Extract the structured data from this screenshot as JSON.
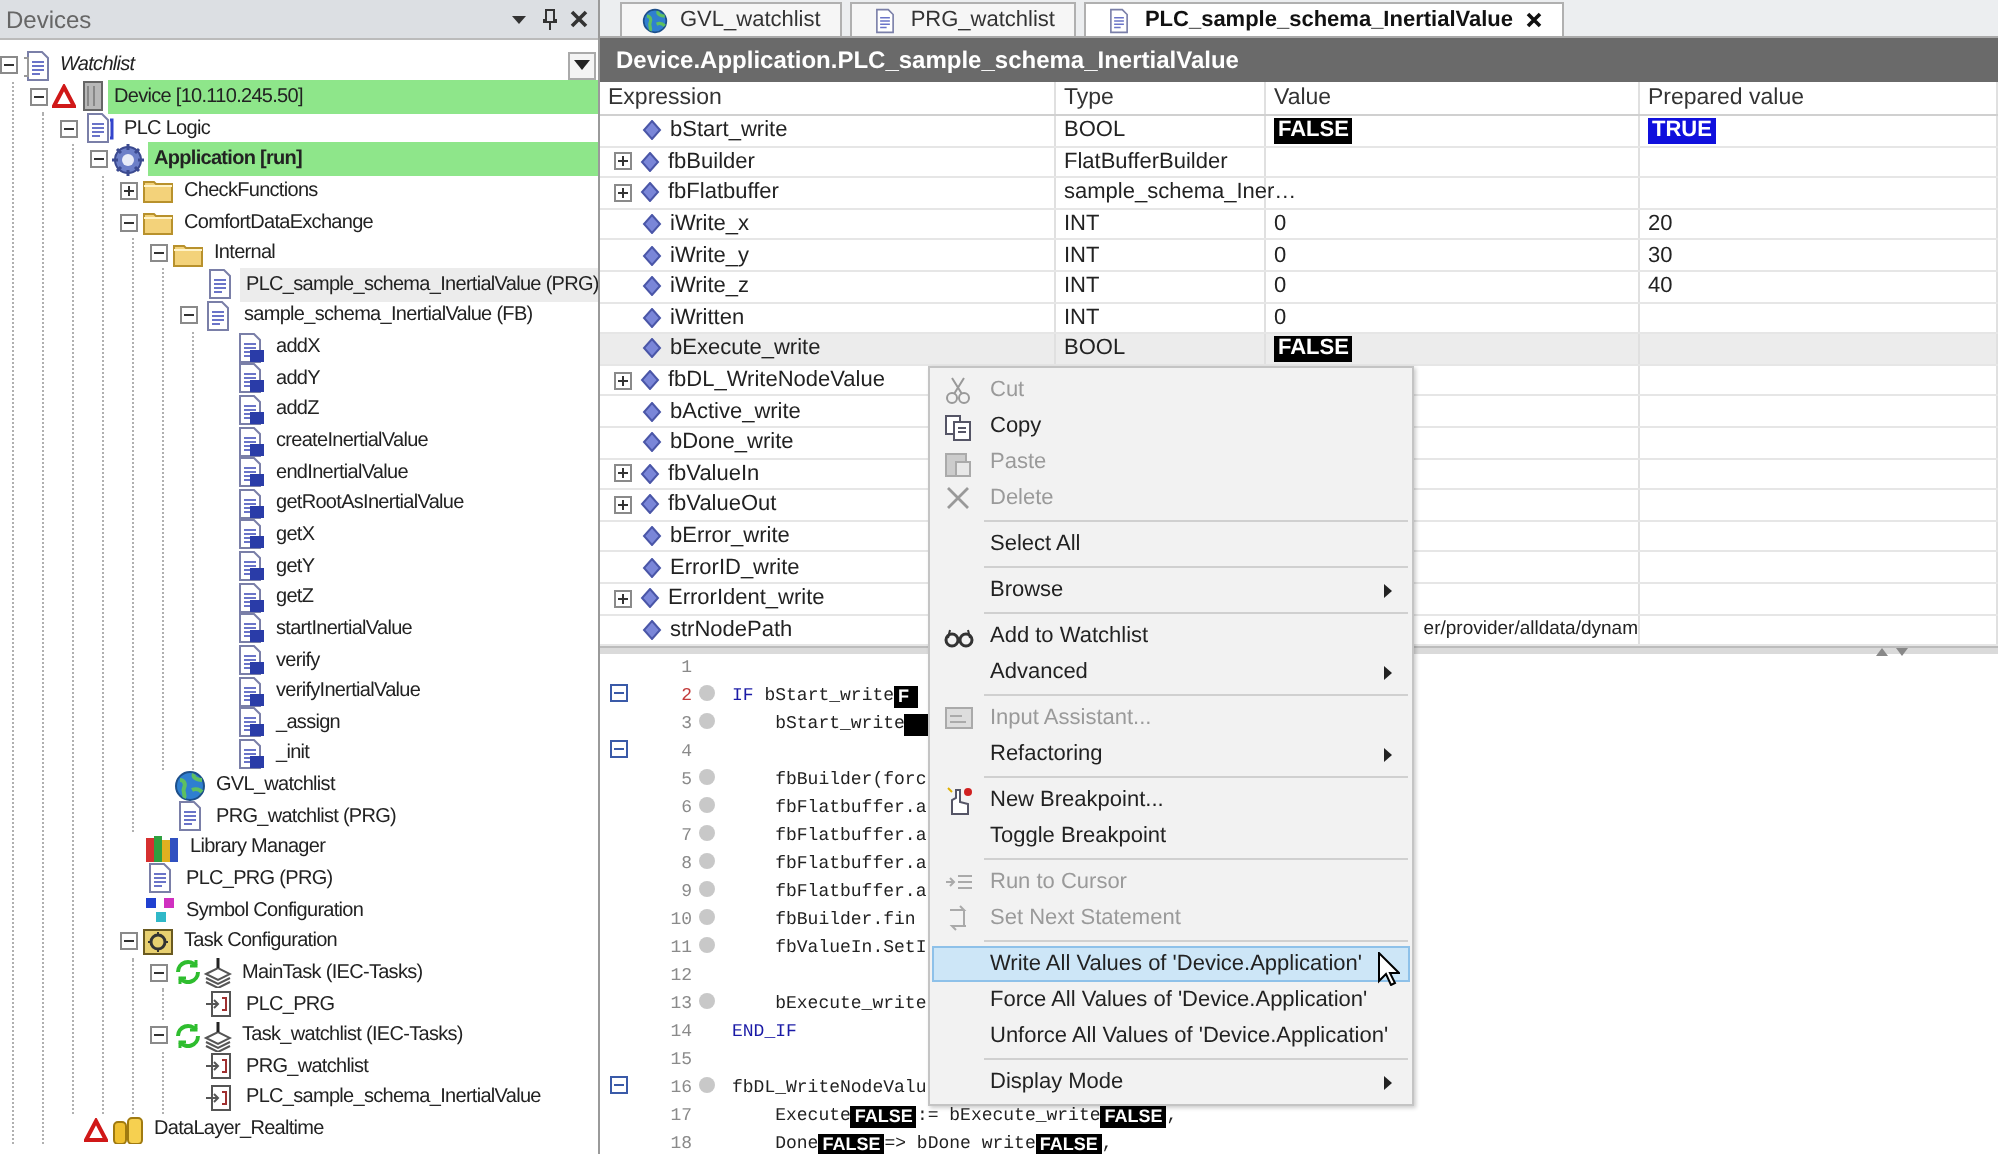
{
  "devices_panel": {
    "title": "Devices",
    "tree": [
      {
        "label": "Watchlist",
        "kind": "watchlist",
        "expanded": true,
        "selected": false,
        "children": [
          {
            "label": "Device  [10.110.245.50]",
            "kind": "device",
            "warning": true,
            "running": true,
            "expanded": true,
            "selected": false,
            "children": [
              {
                "label": "PLC Logic",
                "kind": "plc",
                "expanded": true,
                "selected": false,
                "children": [
                  {
                    "label": "Application [run]",
                    "kind": "application",
                    "running": true,
                    "expanded": true,
                    "selected": false,
                    "children": [
                      {
                        "label": "CheckFunctions",
                        "kind": "folder",
                        "expanded": false,
                        "selected": false
                      },
                      {
                        "label": "ComfortDataExchange",
                        "kind": "folder",
                        "expanded": true,
                        "selected": false,
                        "children": [
                          {
                            "label": "Internal",
                            "kind": "folder",
                            "expanded": true,
                            "selected": false,
                            "children": [
                              {
                                "label": "PLC_sample_schema_InertialValue (PRG)",
                                "kind": "pou",
                                "selected": true
                              },
                              {
                                "label": "sample_schema_InertialValue (FB)",
                                "kind": "pou",
                                "expanded": true,
                                "selected": false,
                                "children": [
                                  {
                                    "label": "addX",
                                    "kind": "method",
                                    "selected": false
                                  },
                                  {
                                    "label": "addY",
                                    "kind": "method",
                                    "selected": false
                                  },
                                  {
                                    "label": "addZ",
                                    "kind": "method",
                                    "selected": false
                                  },
                                  {
                                    "label": "createInertialValue",
                                    "kind": "method",
                                    "selected": false
                                  },
                                  {
                                    "label": "endInertialValue",
                                    "kind": "method",
                                    "selected": false
                                  },
                                  {
                                    "label": "getRootAsInertialValue",
                                    "kind": "method",
                                    "selected": false
                                  },
                                  {
                                    "label": "getX",
                                    "kind": "method",
                                    "selected": false
                                  },
                                  {
                                    "label": "getY",
                                    "kind": "method",
                                    "selected": false
                                  },
                                  {
                                    "label": "getZ",
                                    "kind": "method",
                                    "selected": false
                                  },
                                  {
                                    "label": "startInertialValue",
                                    "kind": "method",
                                    "selected": false
                                  },
                                  {
                                    "label": "verify",
                                    "kind": "method",
                                    "selected": false
                                  },
                                  {
                                    "label": "verifyInertialValue",
                                    "kind": "method",
                                    "selected": false
                                  },
                                  {
                                    "label": "_assign",
                                    "kind": "method",
                                    "selected": false
                                  },
                                  {
                                    "label": "_init",
                                    "kind": "method",
                                    "selected": false
                                  }
                                ]
                              }
                            ]
                          },
                          {
                            "label": "GVL_watchlist",
                            "kind": "gvl",
                            "selected": false
                          },
                          {
                            "label": "PRG_watchlist (PRG)",
                            "kind": "pou",
                            "selected": false
                          }
                        ]
                      },
                      {
                        "label": "Library Manager",
                        "kind": "library",
                        "selected": false
                      },
                      {
                        "label": "PLC_PRG (PRG)",
                        "kind": "pou",
                        "selected": false
                      },
                      {
                        "label": "Symbol Configuration",
                        "kind": "symbol",
                        "selected": false
                      },
                      {
                        "label": "Task Configuration",
                        "kind": "tasks",
                        "expanded": true,
                        "selected": false,
                        "children": [
                          {
                            "label": "MainTask (IEC-Tasks)",
                            "kind": "task",
                            "expanded": true,
                            "selected": false,
                            "children": [
                              {
                                "label": "PLC_PRG",
                                "kind": "call",
                                "selected": false
                              }
                            ]
                          },
                          {
                            "label": "Task_watchlist (IEC-Tasks)",
                            "kind": "task",
                            "expanded": true,
                            "selected": false,
                            "children": [
                              {
                                "label": "PRG_watchlist",
                                "kind": "call",
                                "selected": false
                              },
                              {
                                "label": "PLC_sample_schema_InertialValue",
                                "kind": "call",
                                "selected": false
                              }
                            ]
                          }
                        ]
                      }
                    ]
                  }
                ]
              },
              {
                "label": "DataLayer_Realtime",
                "kind": "datalayer",
                "warning": true,
                "selected": false
              }
            ]
          }
        ]
      }
    ]
  },
  "editor_tabs": [
    {
      "label": "GVL_watchlist",
      "kind": "gvl",
      "selected": false
    },
    {
      "label": "PRG_watchlist",
      "kind": "pou",
      "selected": false
    },
    {
      "label": "PLC_sample_schema_InertialValue",
      "kind": "pou",
      "selected": true
    }
  ],
  "watch_title": "Device.Application.PLC_sample_schema_InertialValue",
  "watch_table": {
    "columns": [
      "Expression",
      "Type",
      "Value",
      "Prepared value"
    ],
    "rows": [
      {
        "expression": "bStart_write",
        "type": "BOOL",
        "value": "FALSE",
        "value_boxed": true,
        "prepared": "TRUE",
        "prepared_boxed": true,
        "selected": false
      },
      {
        "expression": "fbBuilder",
        "expanded": false,
        "type": "FlatBufferBuilder",
        "selected": false
      },
      {
        "expression": "fbFlatbuffer",
        "expanded": false,
        "type": "sample_schema_Iner…",
        "selected": false
      },
      {
        "expression": "iWrite_x",
        "type": "INT",
        "value": "0",
        "value_boxed": false,
        "prepared": "20",
        "prepared_boxed": false,
        "selected": false
      },
      {
        "expression": "iWrite_y",
        "type": "INT",
        "value": "0",
        "value_boxed": false,
        "prepared": "30",
        "prepared_boxed": false,
        "selected": false
      },
      {
        "expression": "iWrite_z",
        "type": "INT",
        "value": "0",
        "value_boxed": false,
        "prepared": "40",
        "prepared_boxed": false,
        "selected": false
      },
      {
        "expression": "iWritten",
        "type": "INT",
        "value": "0",
        "value_boxed": false,
        "selected": false
      },
      {
        "expression": "bExecute_write",
        "type": "BOOL",
        "value": "FALSE",
        "value_boxed": true,
        "selected": true
      },
      {
        "expression": "fbDL_WriteNodeValue",
        "expanded": false,
        "selected": false
      },
      {
        "expression": "bActive_write",
        "selected": false
      },
      {
        "expression": "bDone_write",
        "selected": false
      },
      {
        "expression": "fbValueIn",
        "expanded": false,
        "selected": false
      },
      {
        "expression": "fbValueOut",
        "expanded": false,
        "selected": false
      },
      {
        "expression": "bError_write",
        "selected": false
      },
      {
        "expression": "ErrorID_write",
        "selected": false
      },
      {
        "expression": "ErrorIdent_write",
        "expanded": false,
        "selected": false
      },
      {
        "expression": "strNodePath",
        "value": "er/provider/alldata/dynam",
        "value_boxed": false,
        "selected": false
      }
    ]
  },
  "code": {
    "lines": [
      {
        "number": "1",
        "fold": false,
        "breakpoint": false,
        "current": false
      },
      {
        "number": "2",
        "fold": true,
        "breakpoint": true,
        "current": true,
        "segments": [
          {
            "kind": "keyword",
            "text": "IF"
          },
          {
            "kind": "plain",
            "text": " bStart_write"
          },
          {
            "kind": "value",
            "text": "F"
          }
        ]
      },
      {
        "number": "3",
        "fold": false,
        "breakpoint": true,
        "current": false,
        "segments": [
          {
            "kind": "plain",
            "text": "    bStart_write"
          },
          {
            "kind": "value"
          }
        ]
      },
      {
        "number": "4",
        "fold": true,
        "breakpoint": false,
        "current": false
      },
      {
        "number": "5",
        "fold": false,
        "breakpoint": true,
        "current": false,
        "segments": [
          {
            "kind": "plain",
            "text": "    fbBuilder(forc"
          }
        ]
      },
      {
        "number": "6",
        "fold": false,
        "breakpoint": true,
        "current": false,
        "segments": [
          {
            "kind": "plain",
            "text": "    fbFlatbuffer.a"
          }
        ]
      },
      {
        "number": "7",
        "fold": false,
        "breakpoint": true,
        "current": false,
        "segments": [
          {
            "kind": "plain",
            "text": "    fbFlatbuffer.a"
          }
        ]
      },
      {
        "number": "8",
        "fold": false,
        "breakpoint": true,
        "current": false,
        "segments": [
          {
            "kind": "plain",
            "text": "    fbFlatbuffer.a"
          }
        ]
      },
      {
        "number": "9",
        "fold": false,
        "breakpoint": true,
        "current": false,
        "segments": [
          {
            "kind": "plain",
            "text": "    fbFlatbuffer.a"
          }
        ]
      },
      {
        "number": "10",
        "fold": false,
        "breakpoint": true,
        "current": false,
        "segments": [
          {
            "kind": "plain",
            "text": "    fbBuilder.fin"
          }
        ]
      },
      {
        "number": "11",
        "fold": false,
        "breakpoint": true,
        "current": false,
        "segments": [
          {
            "kind": "plain",
            "text": "    fbValueIn.SetI"
          }
        ]
      },
      {
        "number": "12",
        "fold": false,
        "breakpoint": false,
        "current": false
      },
      {
        "number": "13",
        "fold": false,
        "breakpoint": true,
        "current": false,
        "segments": [
          {
            "kind": "plain",
            "text": "    bExecute_write"
          }
        ]
      },
      {
        "number": "14",
        "fold": false,
        "breakpoint": false,
        "current": false,
        "segments": [
          {
            "kind": "keyword",
            "text": "END_IF"
          }
        ]
      },
      {
        "number": "15",
        "fold": false,
        "breakpoint": false,
        "current": false
      },
      {
        "number": "16",
        "fold": true,
        "breakpoint": true,
        "current": false,
        "segments": [
          {
            "kind": "plain",
            "text": "fbDL_WriteNodeValu"
          }
        ]
      },
      {
        "number": "17",
        "fold": false,
        "breakpoint": false,
        "current": false,
        "segments": [
          {
            "kind": "plain",
            "text": "    Execute"
          },
          {
            "kind": "value",
            "text": "FALSE"
          },
          {
            "kind": "plain",
            "text": ":= bExecute_write"
          },
          {
            "kind": "value",
            "text": "FALSE"
          },
          {
            "kind": "plain",
            "text": ","
          }
        ]
      },
      {
        "number": "18",
        "fold": false,
        "breakpoint": false,
        "current": false,
        "segments": [
          {
            "kind": "plain",
            "text": "    Done"
          },
          {
            "kind": "value",
            "text": "FALSE"
          },
          {
            "kind": "plain",
            "text": "=> bDone write"
          },
          {
            "kind": "value",
            "text": "FALSE"
          },
          {
            "kind": "plain",
            "text": ","
          }
        ]
      }
    ]
  },
  "context_menu": {
    "items": [
      {
        "kind": "item",
        "label": "Cut",
        "disabled": true,
        "submenu": false,
        "selected": false
      },
      {
        "kind": "item",
        "label": "Copy",
        "disabled": false,
        "submenu": false,
        "selected": false
      },
      {
        "kind": "item",
        "label": "Paste",
        "disabled": true,
        "submenu": false,
        "selected": false
      },
      {
        "kind": "item",
        "label": "Delete",
        "disabled": true,
        "submenu": false,
        "selected": false
      },
      {
        "kind": "separator"
      },
      {
        "kind": "item",
        "label": "Select All",
        "disabled": false,
        "submenu": false,
        "selected": false
      },
      {
        "kind": "separator"
      },
      {
        "kind": "item",
        "label": "Browse",
        "disabled": false,
        "submenu": true,
        "selected": false
      },
      {
        "kind": "separator"
      },
      {
        "kind": "item",
        "label": "Add to Watchlist",
        "disabled": false,
        "submenu": false,
        "selected": false
      },
      {
        "kind": "item",
        "label": "Advanced",
        "disabled": false,
        "submenu": true,
        "selected": false
      },
      {
        "kind": "separator"
      },
      {
        "kind": "item",
        "label": "Input Assistant...",
        "disabled": true,
        "submenu": false,
        "selected": false
      },
      {
        "kind": "item",
        "label": "Refactoring",
        "disabled": false,
        "submenu": true,
        "selected": false
      },
      {
        "kind": "separator"
      },
      {
        "kind": "item",
        "label": "New Breakpoint...",
        "disabled": false,
        "submenu": false,
        "selected": false
      },
      {
        "kind": "item",
        "label": "Toggle Breakpoint",
        "disabled": false,
        "submenu": false,
        "selected": false
      },
      {
        "kind": "separator"
      },
      {
        "kind": "item",
        "label": "Run to Cursor",
        "disabled": true,
        "submenu": false,
        "selected": false
      },
      {
        "kind": "item",
        "label": "Set Next Statement",
        "disabled": true,
        "submenu": false,
        "selected": false
      },
      {
        "kind": "separator"
      },
      {
        "kind": "item",
        "label": "Write All Values of 'Device.Application'",
        "disabled": false,
        "submenu": false,
        "selected": true
      },
      {
        "kind": "item",
        "label": "Force All Values of 'Device.Application'",
        "disabled": false,
        "submenu": false,
        "selected": false
      },
      {
        "kind": "item",
        "label": "Unforce All Values of 'Device.Application'",
        "disabled": false,
        "submenu": false,
        "selected": false
      },
      {
        "kind": "separator"
      },
      {
        "kind": "item",
        "label": "Display Mode",
        "disabled": false,
        "submenu": true,
        "selected": false
      }
    ]
  }
}
